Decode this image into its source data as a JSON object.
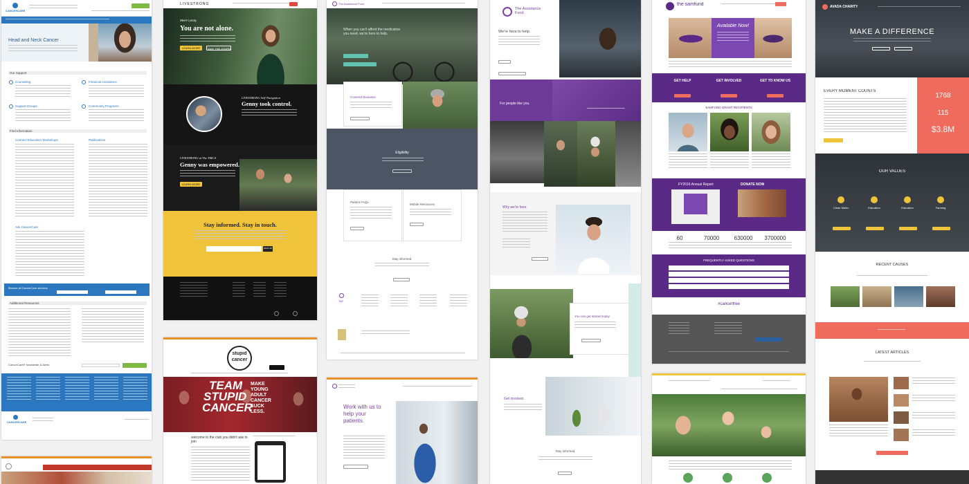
{
  "colors": {
    "cancercare_blue": "#2b78c0",
    "livestrong_yellow": "#f0c43a",
    "taf_purple": "#7b3fa0",
    "samfund_purple": "#5a2a86",
    "avada_coral": "#ef6b5e",
    "stupid_red": "#a3282e"
  },
  "cancercare": {
    "logo": "CANCERCARE",
    "hero_title": "Head and Neck Cancer",
    "sec_support": "Our Support",
    "items": [
      "Counseling",
      "Financial Assistance",
      "Support Groups",
      "Community Programs"
    ],
    "sec_education": "Find Information",
    "edu_items": [
      "Connect Education Workshops",
      "Publications"
    ],
    "ask": "Ask CancerCare",
    "browse": "Browse all CancerCare services",
    "resources": "Additional Resources",
    "newsletter": "CancerCare® Newsletter & Alerts",
    "footer_logo": "CANCERCARE"
  },
  "livestrong": {
    "brand": "LIVESTRONG",
    "eyebrow": "Meet Genny",
    "title": "You are not alone.",
    "btn1": "LEARN MORE",
    "btn2": "TAKE THE JOURNEY",
    "nav_label": "LIVESTRONG Self-Navigation",
    "nav_title": "Genny took control.",
    "ymca_label": "LIVESTRONG at The YMCA",
    "ymca_title": "Genny was empowered.",
    "ymca_btn": "LEARN MORE",
    "stay": "Stay informed. Stay in touch.",
    "signup": "SIGN UP"
  },
  "taf": {
    "logo": "The Assistance Fund",
    "hero": "When you can't afford the medication you need, we're here to help.",
    "covered": "Covered Diseases",
    "eligibility": "Eligibility",
    "faq": "Patient FAQs",
    "resources": "Mobile Resources",
    "stay": "Stay informed.",
    "footer_logo": "TAF",
    "work": "Work with us to help your patients."
  },
  "taf2": {
    "logo": "The Assistance Fund",
    "help": "We're here to help.",
    "for_people": "For people like you.",
    "why": "Why we're here",
    "started": "You can get started today.",
    "involved": "Get involved.",
    "stay": "Stay informed."
  },
  "samfund": {
    "logo": "the samfund",
    "available": "Available Now!",
    "col1": "GET HELP",
    "col2": "GET INVOLVED",
    "col3": "GET TO KNOW US",
    "recipients": "SAMFUND GRANT RECIPIENTS",
    "report": "FY2016 Annual Report",
    "donate": "DONATE NOW",
    "stats": [
      "60",
      "70000",
      "630000",
      "3700000"
    ],
    "faq": "FREQUENTLY ASKED QUESTIONS",
    "hashtag": "#cancerfree"
  },
  "avada": {
    "logo": "AVADA CHARITY",
    "hero": "MAKE A DIFFERENCE",
    "counts": "EVERY MOMENT COUNTS",
    "stats": [
      "1768",
      "115",
      "$3.8M"
    ],
    "values": "OUR VALUES",
    "value_items": [
      "Clean Water",
      "Education",
      "Education",
      "Farming"
    ],
    "causes": "RECENT CAUSES",
    "articles": "LATEST ARTICLES"
  },
  "stupid": {
    "logo_line1": "stupid",
    "logo_line2": "cancer",
    "hero1": "TEAM",
    "hero2": "STUPID",
    "hero3": "CANCER",
    "hero_side": "MAKE YOUNG ADULT CANCER SUCK LESS.",
    "welcome": "welcome to the club you didn't ask to join"
  }
}
